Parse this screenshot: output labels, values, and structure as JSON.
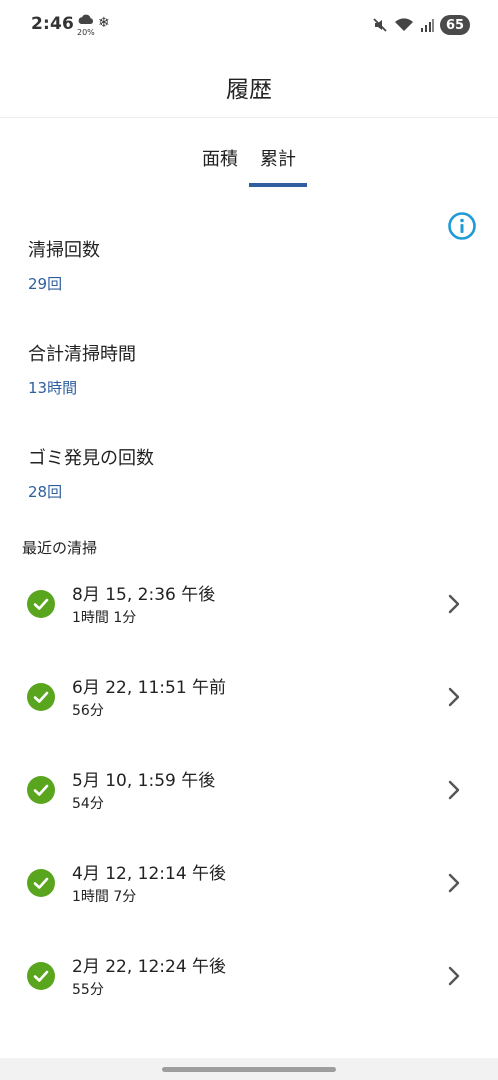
{
  "status_bar": {
    "time": "2:46",
    "rain_chance": "20%",
    "battery": "65",
    "icons": [
      "cloud-rain-icon",
      "snowflake-icon",
      "mute-icon",
      "wifi-icon",
      "signal-icon",
      "battery-icon"
    ]
  },
  "header": {
    "title": "履歴"
  },
  "tabs": [
    {
      "label": "面積",
      "selected": false
    },
    {
      "label": "累計",
      "selected": true
    }
  ],
  "stats": [
    {
      "label": "清掃回数",
      "value": "29回"
    },
    {
      "label": "合計清掃時間",
      "value": "13時間"
    },
    {
      "label": "ゴミ発見の回数",
      "value": "28回"
    }
  ],
  "recent": {
    "title": "最近の清掃",
    "items": [
      {
        "date": "8月 15, 2:36 午後",
        "duration": "1時間 1分",
        "status": "completed"
      },
      {
        "date": "6月 22, 11:51 午前",
        "duration": "56分",
        "status": "completed"
      },
      {
        "date": "5月 10, 1:59 午後",
        "duration": "54分",
        "status": "completed"
      },
      {
        "date": "4月 12, 12:14 午後",
        "duration": "1時間 7分",
        "status": "completed"
      },
      {
        "date": "2月 22, 12:24 午後",
        "duration": "55分",
        "status": "completed"
      }
    ]
  },
  "colors": {
    "accent": "#2f5f9e",
    "info": "#1e9ad6",
    "success": "#5aa51e"
  }
}
